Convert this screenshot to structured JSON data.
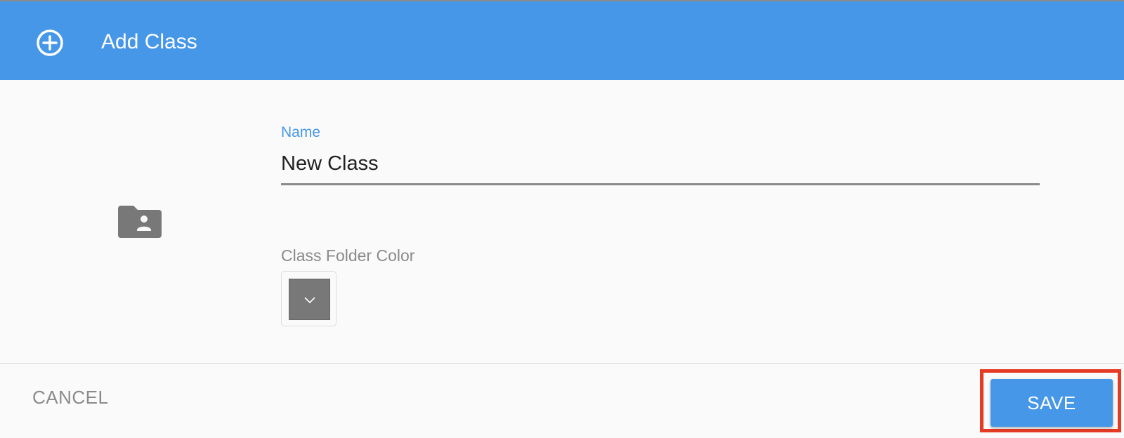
{
  "header": {
    "title": "Add Class",
    "icon": "add-circle-icon",
    "background_color": "#4797e9"
  },
  "form": {
    "name_label": "Name",
    "name_value": "New Class",
    "folder_icon": "folder-shared-icon",
    "color_label": "Class Folder Color",
    "selected_color": "#787878"
  },
  "footer": {
    "cancel_label": "CANCEL",
    "save_label": "SAVE",
    "highlight_color": "#e53a24"
  }
}
